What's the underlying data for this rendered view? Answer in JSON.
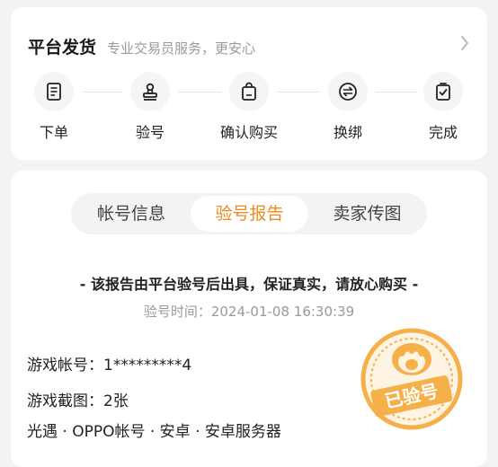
{
  "platform": {
    "title": "平台发货",
    "subtitle": "专业交易员服务，更安心"
  },
  "steps": [
    {
      "label": "下单",
      "icon": "order-document-icon"
    },
    {
      "label": "验号",
      "icon": "stamp-icon"
    },
    {
      "label": "确认购买",
      "icon": "shopping-bag-icon"
    },
    {
      "label": "换绑",
      "icon": "exchange-icon"
    },
    {
      "label": "完成",
      "icon": "checked-box-icon"
    }
  ],
  "tabs": [
    {
      "label": "帐号信息",
      "active": false
    },
    {
      "label": "验号报告",
      "active": true
    },
    {
      "label": "卖家传图",
      "active": false
    }
  ],
  "report": {
    "title": "- 该报告由平台验号后出具，保证真实，请放心购买 -",
    "time_label": "验号时间：",
    "time_value": "2024-01-08 16:30:39"
  },
  "info": {
    "account": "游戏帐号：1*********4",
    "screenshots": "游戏截图：2张",
    "tags": "光遇 · OPPO帐号 · 安卓 · 安卓服务器"
  },
  "stamp": {
    "text": "已验号",
    "icon": "paw-icon"
  },
  "colors": {
    "accent": "#f08a1c",
    "stamp": "#f6b04a",
    "background": "#f3f3f3"
  }
}
